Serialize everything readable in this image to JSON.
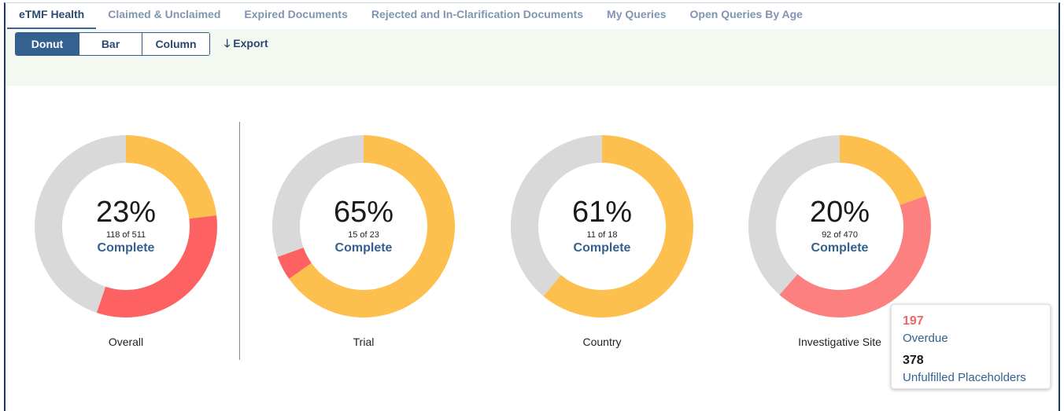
{
  "tabs": [
    {
      "label": "eTMF Health",
      "active": true
    },
    {
      "label": "Claimed & Unclaimed",
      "active": false
    },
    {
      "label": "Expired Documents",
      "active": false
    },
    {
      "label": "Rejected and In-Clarification Documents",
      "active": false
    },
    {
      "label": "My Queries",
      "active": false
    },
    {
      "label": "Open Queries By Age",
      "active": false
    }
  ],
  "toolbar": {
    "chart_types": [
      {
        "label": "Donut",
        "active": true
      },
      {
        "label": "Bar",
        "active": false
      },
      {
        "label": "Column",
        "active": false
      }
    ],
    "export_label": "Export",
    "export_icon": "arrow-down-icon"
  },
  "colors": {
    "complete": "#fdbf4e",
    "overdue_bright": "#fd6161",
    "overdue_soft": "#fd8080",
    "unfulfilled": "#d9d9d9",
    "accent": "#34618f"
  },
  "donuts": [
    {
      "name": "Overall",
      "percent": "23%",
      "fraction": "118 of 511",
      "status": "Complete",
      "segments": {
        "complete": 118,
        "overdue": 164,
        "unfulfilled": 229
      },
      "overdue_color": "overdue_bright"
    },
    {
      "name": "Trial",
      "percent": "65%",
      "fraction": "15 of 23",
      "status": "Complete",
      "segments": {
        "complete": 15,
        "overdue": 1,
        "unfulfilled": 7
      },
      "overdue_color": "overdue_bright"
    },
    {
      "name": "Country",
      "percent": "61%",
      "fraction": "11 of 18",
      "status": "Complete",
      "segments": {
        "complete": 11,
        "overdue": 0,
        "unfulfilled": 7
      },
      "overdue_color": "overdue_bright"
    },
    {
      "name": "Investigative Site",
      "percent": "20%",
      "fraction": "92 of 470",
      "status": "Complete",
      "segments": {
        "complete": 92,
        "overdue": 197,
        "unfulfilled": 181
      },
      "overdue_color": "overdue_soft"
    }
  ],
  "tooltip": {
    "value1": "197",
    "label1": "Overdue",
    "value2": "378",
    "label2": "Unfulfilled Placeholders"
  }
}
